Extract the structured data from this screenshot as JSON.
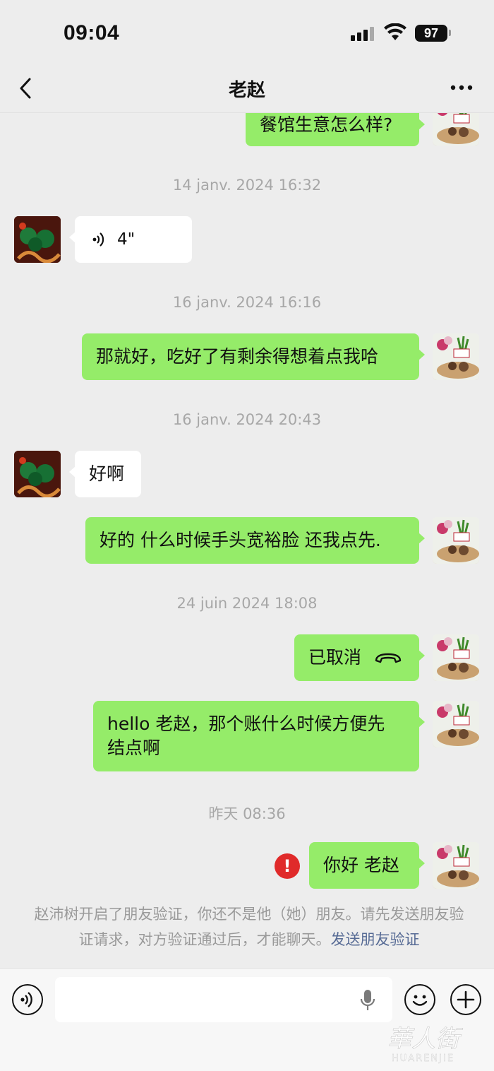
{
  "status_bar": {
    "time": "09:04",
    "battery": "97"
  },
  "header": {
    "title": "老赵"
  },
  "messages": [
    {
      "from": "me",
      "text": "餐馆生意怎么样?"
    },
    {
      "timestamp": "14 janv. 2024 16:32"
    },
    {
      "from": "them",
      "voice_duration": "4\""
    },
    {
      "timestamp": "16 janv. 2024 16:16"
    },
    {
      "from": "me",
      "text": "那就好，吃好了有剩余得想着点我哈"
    },
    {
      "timestamp": "16 janv. 2024 20:43"
    },
    {
      "from": "them",
      "text": "好啊"
    },
    {
      "from": "me",
      "text": "好的 什么时候手头宽裕脸 还我点先."
    },
    {
      "timestamp": "24 juin 2024 18:08"
    },
    {
      "from": "me",
      "call_status": "已取消"
    },
    {
      "from": "me",
      "text_line1": "hello 老赵，那个账什么时候方便先",
      "text_line2": "结点啊"
    },
    {
      "timestamp": "昨天 08:36"
    },
    {
      "from": "me",
      "text": "你好 老赵",
      "failed_indicator": "!"
    }
  ],
  "footer_note": {
    "text": "赵沛树开启了朋友验证，你还不是他（她）朋友。请先发送朋友验证请求，对方验证通过后，才能聊天。",
    "link": "发送朋友验证"
  },
  "watermark": {
    "logo_text": "華人街",
    "sub_text": "HUARENJIE"
  },
  "colors": {
    "my_bubble": "#95ec69",
    "their_bubble": "#ffffff",
    "background": "#ededed",
    "link": "#576b95",
    "error": "#e02a2a"
  },
  "icons": [
    "back-icon",
    "more-icon",
    "voice-wave-icon",
    "hangup-icon",
    "error-icon",
    "voice-mode-icon",
    "mic-icon",
    "emoji-icon",
    "plus-icon"
  ]
}
